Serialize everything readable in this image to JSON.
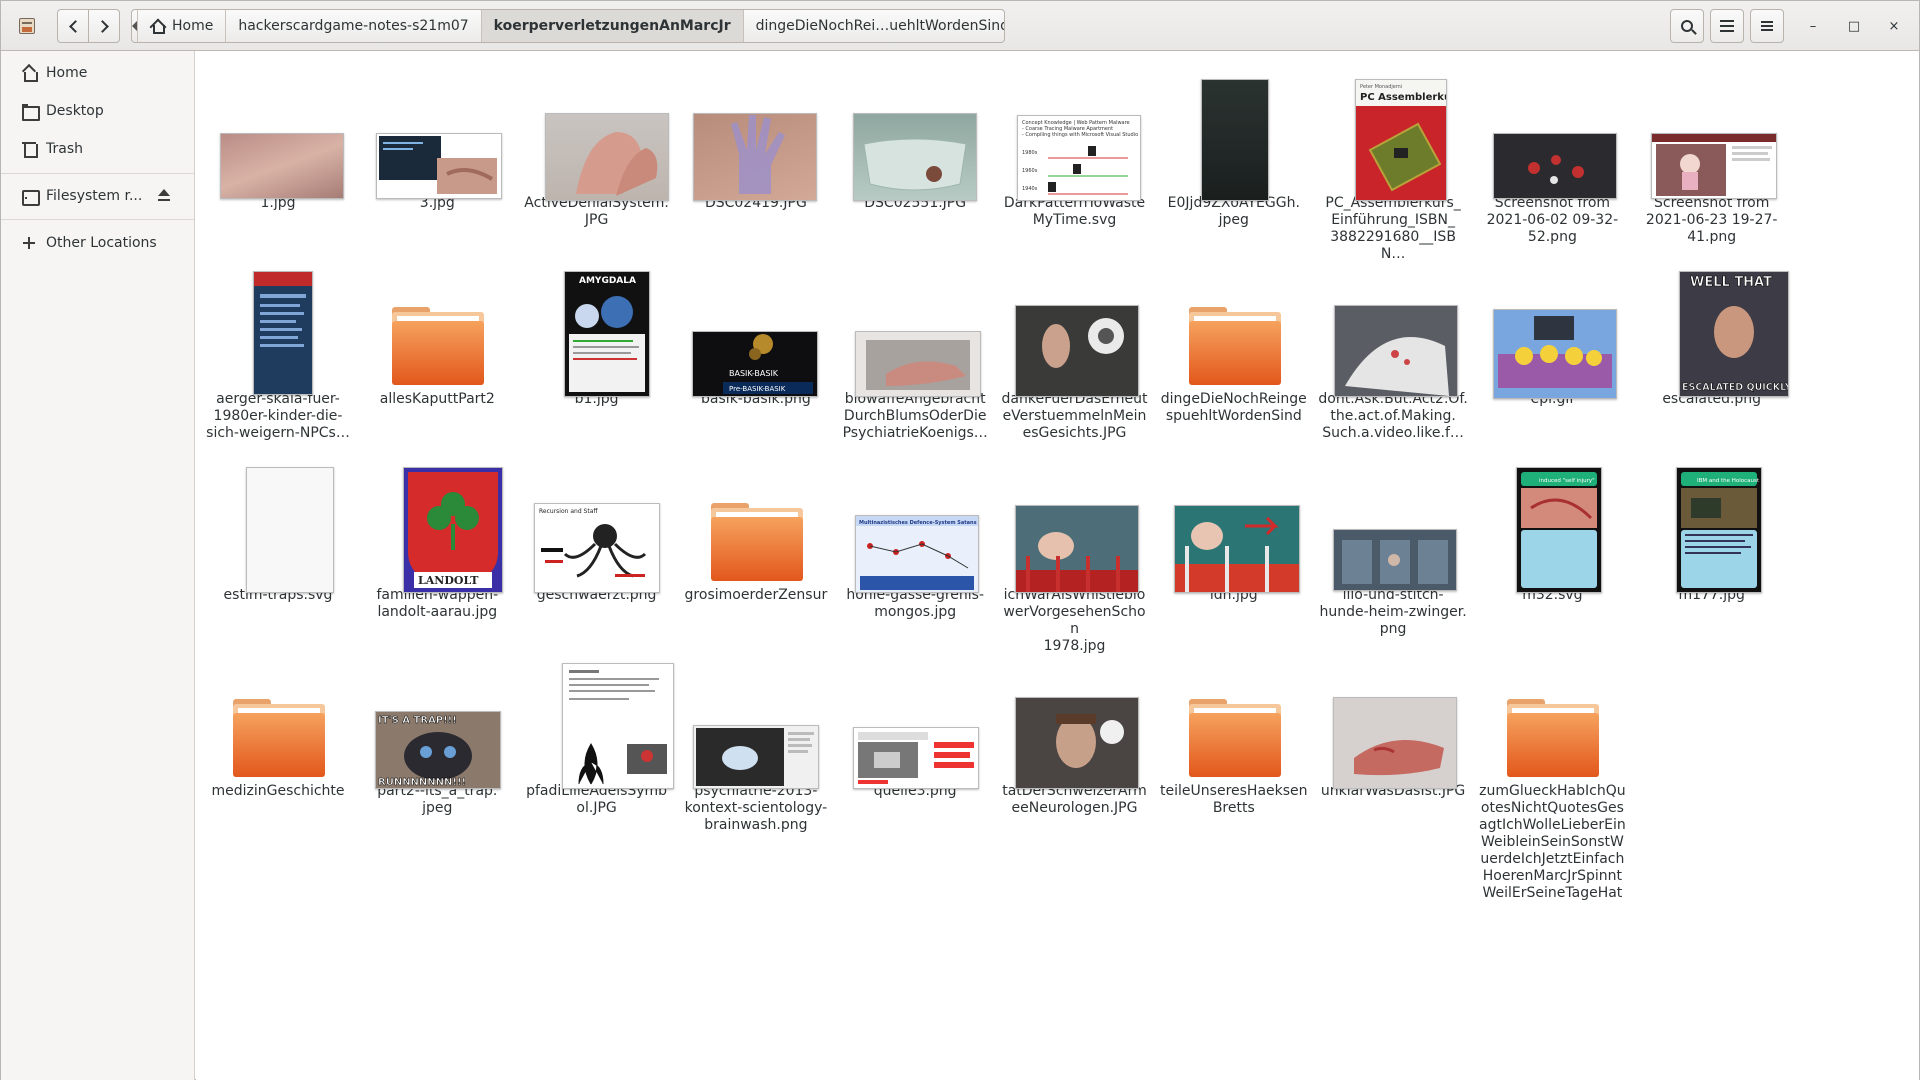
{
  "window": {
    "title": "koerperverletzungenAnMarcJr"
  },
  "header": {
    "breadcrumbs": [
      {
        "label": "Home",
        "active": false
      },
      {
        "label": "hackerscardgame-notes-s21m07",
        "active": false
      },
      {
        "label": "koerperverletzungenAnMarcJr",
        "active": true
      },
      {
        "label": "dingeDieNochRei…uehltWordenSind",
        "active": false
      }
    ],
    "icons": {
      "search": "search-icon",
      "view": "list-view-icon",
      "menu": "hamburger-menu-icon"
    },
    "window_controls": {
      "minimize": "–",
      "maximize": "□",
      "close": "×"
    }
  },
  "sidebar": {
    "items": [
      {
        "label": "Home",
        "icon": "home-icon"
      },
      {
        "label": "Desktop",
        "icon": "folder-icon"
      },
      {
        "label": "Trash",
        "icon": "trash-icon"
      },
      {
        "label": "Filesystem r...",
        "icon": "disk-icon"
      },
      {
        "label": "Other Locations",
        "icon": "plus-icon"
      }
    ]
  },
  "files": [
    {
      "name": "1.jpg",
      "kind": "image",
      "thumb": "skin"
    },
    {
      "name": "3.jpg",
      "kind": "image",
      "thumb": "screen-hand"
    },
    {
      "name": "ActiveDenialSystem.\nJPG",
      "kind": "image",
      "thumb": "feet"
    },
    {
      "name": "DSC02419.JPG",
      "kind": "image",
      "thumb": "hand-purple"
    },
    {
      "name": "DSC02551.JPG",
      "kind": "image",
      "thumb": "mask"
    },
    {
      "name": "DarkPatternToWaste\nMyTime.svg",
      "kind": "image",
      "thumb": "diagram-lines"
    },
    {
      "name": "E0Jjd9ZXoAYEGGh.\njpeg",
      "kind": "image",
      "thumb": "dark"
    },
    {
      "name": "PC_Assemblerkurs_\nEinführung_ISBN_\n3882291680__ISBN…",
      "kind": "image",
      "thumb": "book"
    },
    {
      "name": "Screenshot from\n2021-06-02 09-32-\n52.png",
      "kind": "image",
      "thumb": "dark-red"
    },
    {
      "name": "Screenshot from\n2021-06-23 19-27-\n41.png",
      "kind": "image",
      "thumb": "web-doll"
    },
    {
      "name": "aerger-skala-fuer-\n1980er-kinder-die-\nsich-weigern-NPCs…",
      "kind": "image",
      "thumb": "phone-blue"
    },
    {
      "name": "allesKaputtPart2",
      "kind": "folder",
      "thumb": "folder"
    },
    {
      "name": "b1.jpg",
      "kind": "image",
      "thumb": "card-brain"
    },
    {
      "name": "basik-basik.png",
      "kind": "image",
      "thumb": "basik"
    },
    {
      "name": "biowaffeAngebracht\nDurchBlumsOderDie\nPsychiatrieKoenigs…",
      "kind": "image",
      "thumb": "hand-grey"
    },
    {
      "name": "dankeFuerDasErneut\neVerstuemmelnMein\nesGesichts.JPG",
      "kind": "image",
      "thumb": "selfie"
    },
    {
      "name": "dingeDieNochReinge\nspuehltWordenSind",
      "kind": "folder",
      "thumb": "folder"
    },
    {
      "name": "dont.Ask.But.Act2.Of.\nthe.act.of.Making.\nSuch.a.video.like.f…",
      "kind": "image",
      "thumb": "bed"
    },
    {
      "name": "epi.gif",
      "kind": "image",
      "thumb": "simpsons"
    },
    {
      "name": "escalated.png",
      "kind": "image",
      "thumb": "meme"
    },
    {
      "name": "estim-traps.svg",
      "kind": "image",
      "thumb": "blank"
    },
    {
      "name": "familien-wappen-\nlandolt-aarau.jpg",
      "kind": "image",
      "thumb": "crest"
    },
    {
      "name": "geschwaerzt.png",
      "kind": "image",
      "thumb": "octopus"
    },
    {
      "name": "grosimoerderZensur",
      "kind": "folder",
      "thumb": "folder"
    },
    {
      "name": "hohle-gasse-grenis-\nmongos.jpg",
      "kind": "image",
      "thumb": "diagram-blue"
    },
    {
      "name": "ichWarAlsWhistleblo\nwerVorgesehenSchon\n1978.jpg",
      "kind": "image",
      "thumb": "baby"
    },
    {
      "name": "idh.jpg",
      "kind": "image",
      "thumb": "baby2"
    },
    {
      "name": "lilo-und-stitch-\nhunde-heim-zwinger.\npng",
      "kind": "image",
      "thumb": "cells"
    },
    {
      "name": "m32.svg",
      "kind": "image",
      "thumb": "card-green"
    },
    {
      "name": "m177.jpg",
      "kind": "image",
      "thumb": "card-green2"
    },
    {
      "name": "medizinGeschichte",
      "kind": "folder",
      "thumb": "folder"
    },
    {
      "name": "part2--its_a_trap.\njpeg",
      "kind": "image",
      "thumb": "kitten"
    },
    {
      "name": "pfadiLilieAdelsSymb\nol.JPG",
      "kind": "image",
      "thumb": "doc-lily"
    },
    {
      "name": "psychiatrie-2013-\nkontext-scientology-\nbrainwash.png",
      "kind": "image",
      "thumb": "video"
    },
    {
      "name": "quelle3.png",
      "kind": "image",
      "thumb": "youtube"
    },
    {
      "name": "tatDerSchweizerArm\neeNeurologen.JPG",
      "kind": "image",
      "thumb": "selfie2"
    },
    {
      "name": "teileUnseresHaeksen\nBretts",
      "kind": "folder",
      "thumb": "folder"
    },
    {
      "name": "unklarWasDasIst.JPG",
      "kind": "image",
      "thumb": "hand-red"
    },
    {
      "name": "zumGlueckHabIchQu\notesNichtQuotesGes\nagtIchWolleLieberEin\nWeibleinSeinSonstW\nuerdeIchJetztEinfach\nHoerenMarcJrSpinnt\nWeilErSeineTageHat",
      "kind": "folder",
      "thumb": "folder"
    }
  ],
  "thumb_text": {
    "book_title": "PC Assemblerkurs",
    "book_author": "Peter Monadjemi",
    "card_b1": "AMYGDALA",
    "basik_top": "BASIK-BASIK",
    "basik_bottom": "Pre-BASIK-BASIK",
    "meme_top": "WELL THAT",
    "meme_bottom": "ESCALATED QUICKLY",
    "crest": "LANDOLT",
    "octo_title": "Recursion and Staff",
    "diagram_title": "Multinazistisches Defence-System Satans",
    "kitten_top": "IT'S A TRAP!!!",
    "kitten_bottom": "RUNNNNNNN!!!",
    "m32_title": "induced \"self injury\"",
    "m177_title": "IBM and the Holocaust",
    "dark_pattern_line1": "Concept Knowledge | Web Pattern Malware",
    "dark_pattern_line2": "- Coarse Tracing Malware Apartment",
    "dark_pattern_line3": "- Compiling things with Microsoft Visual Studio",
    "years": [
      "1980s",
      "1960s",
      "1940s"
    ]
  },
  "colors": {
    "folder_orange": "#e86d2b",
    "selection": "#dcdad6",
    "sidebar_bg": "#f6f5f4"
  }
}
